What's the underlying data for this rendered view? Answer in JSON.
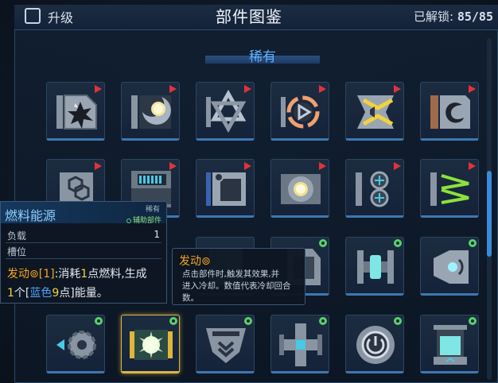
{
  "header": {
    "upgrade_label": "升级",
    "title": "部件图鉴",
    "unlocked_label": "已解锁:",
    "unlocked_value": "85/85"
  },
  "section": {
    "title": "稀有"
  },
  "tiles": [
    {
      "icon": "explosion-part-icon",
      "badge": "red-flag"
    },
    {
      "icon": "moon-light-part-icon",
      "badge": "red-flag"
    },
    {
      "icon": "star-of-david-part-icon",
      "badge": "red-flag"
    },
    {
      "icon": "play-ring-part-icon",
      "badge": "red-flag"
    },
    {
      "icon": "yellow-chevron-part-icon",
      "badge": "red-flag"
    },
    {
      "icon": "dragon-emblem-part-icon",
      "badge": "red-flag"
    },
    {
      "icon": "hex-grid-part-icon",
      "badge": "red-flag"
    },
    {
      "icon": "fuel-cell-part-icon",
      "badge": "red-flag"
    },
    {
      "icon": "gear-frame-part-icon",
      "badge": "red-flag"
    },
    {
      "icon": "yellow-core-gear-part-icon",
      "badge": "red-flag"
    },
    {
      "icon": "twin-crosshair-part-icon",
      "badge": "red-flag"
    },
    {
      "icon": "green-arrows-part-icon",
      "badge": "red-flag"
    },
    {
      "icon": "crate-part-icon",
      "badge": "green-gear"
    },
    {
      "icon": "cyan-tube-part-icon",
      "badge": "green-gear"
    },
    {
      "icon": "speaker-part-icon",
      "badge": "green-gear"
    },
    {
      "icon": "arrow-gear-part-icon",
      "badge": "green-gear"
    },
    {
      "icon": "energy-burst-part-icon",
      "badge": "green-gear"
    },
    {
      "icon": "shield-chevron-part-icon",
      "badge": "green-gear"
    },
    {
      "icon": "cross-junction-part-icon",
      "badge": "green-gear"
    },
    {
      "icon": "power-dial-part-icon",
      "badge": "green-gear"
    },
    {
      "icon": "liquid-tank-part-icon",
      "badge": "green-gear"
    }
  ],
  "tooltip_part": {
    "name": "燃料能源",
    "rarity": "稀有",
    "kind": "辅助部件",
    "load_label": "负载",
    "load_value": "1",
    "slot_label": "槽位",
    "effect_prefix": "发动",
    "effect_cost": "[1]",
    "effect_line1_a": ":消耗",
    "effect_line1_num": "1",
    "effect_line1_b": "点燃料,生成",
    "effect_line2_num1": "1",
    "effect_line2_a": "个[",
    "effect_line2_color": "蓝色",
    "effect_line2_num2": "9",
    "effect_line2_b": "点]能量。"
  },
  "tooltip_keyword": {
    "title": "发动",
    "line1": "点击部件时,触发其效果,并",
    "line2": "进入冷却。数值代表冷却回合",
    "line3": "数。"
  },
  "colors": {
    "accent_blue": "#4ca2ff",
    "accent_orange": "#f5a623",
    "accent_yellow": "#f4d33c",
    "flag_red": "#e0333a",
    "gear_green": "#58d36a"
  }
}
